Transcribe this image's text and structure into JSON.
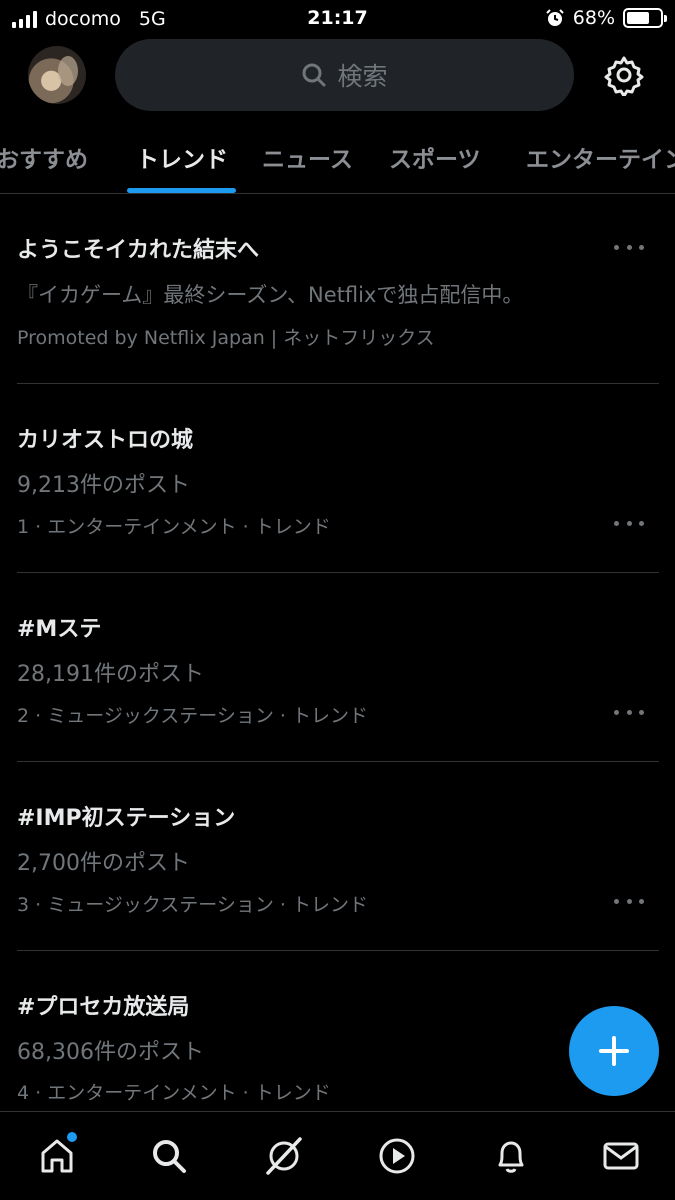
{
  "status_bar": {
    "carrier": "docomo",
    "network": "5G",
    "time": "21:17",
    "battery": "68%",
    "battery_level": 0.68
  },
  "header": {
    "search_placeholder": "検索"
  },
  "tabs": [
    {
      "label": "おすすめ"
    },
    {
      "label": "トレンド"
    },
    {
      "label": "ニュース"
    },
    {
      "label": "スポーツ"
    },
    {
      "label": "エンターテイン"
    }
  ],
  "promoted": {
    "title": "ようこそイカれた結末へ",
    "description": "『イカゲーム』最終シーズン、Netflixで独占配信中。",
    "promoted_by": "Promoted by Netflix Japan | ネットフリックス"
  },
  "trends": [
    {
      "title": "カリオストロの城",
      "count": "9,213件のポスト",
      "meta": "1 · エンターテインメント · トレンド"
    },
    {
      "title": "#Mステ",
      "count": "28,191件のポスト",
      "meta": "2 · ミュージックステーション · トレンド"
    },
    {
      "title": "#IMP初ステーション",
      "count": "2,700件のポスト",
      "meta": "3 · ミュージックステーション · トレンド"
    },
    {
      "title": "#プロセカ放送局",
      "count": "68,306件のポスト",
      "meta": "4 · エンターテインメント · トレンド"
    }
  ],
  "colors": {
    "accent": "#1d9bf0",
    "background": "#000000",
    "muted_text": "#71767b"
  }
}
